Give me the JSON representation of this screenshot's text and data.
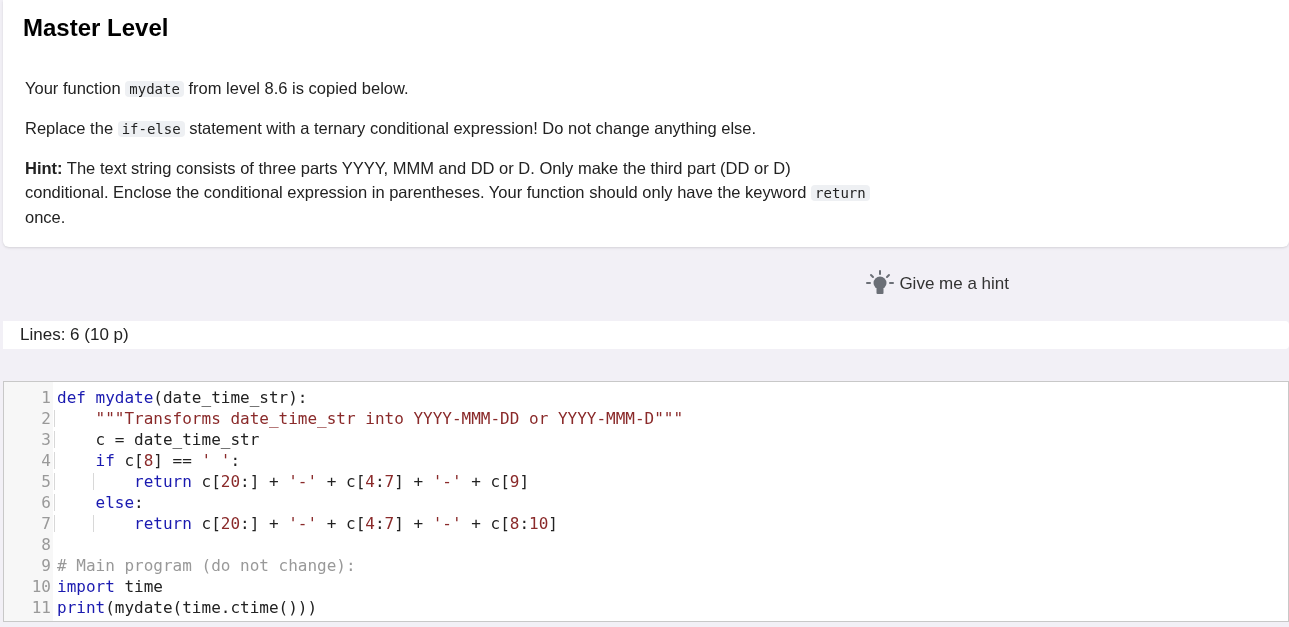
{
  "title": "Master Level",
  "paragraphs": [
    [
      {
        "kind": "text",
        "text": "Your function "
      },
      {
        "kind": "code",
        "text": "mydate"
      },
      {
        "kind": "text",
        "text": " from level 8.6 is copied below."
      }
    ],
    [
      {
        "kind": "text",
        "text": "Replace the "
      },
      {
        "kind": "code",
        "text": "if-else"
      },
      {
        "kind": "text",
        "text": " statement with a ternary conditional expression! Do not change anything else."
      }
    ],
    [
      {
        "kind": "bold",
        "text": "Hint:"
      },
      {
        "kind": "text",
        "text": " The text string consists of three parts YYYY, MMM and DD or D. Only make the third part (DD or D) conditional. Enclose the conditional expression in parentheses. Your function should only have the keyword "
      },
      {
        "kind": "code",
        "text": "return"
      },
      {
        "kind": "text",
        "text": " once."
      }
    ]
  ],
  "hint_button": "Give me a hint",
  "lines_info": "Lines: 6 (10 p)",
  "code_lines": [
    {
      "number": "1",
      "tokens": [
        {
          "kind": "kw",
          "text": "def "
        },
        {
          "kind": "fn",
          "text": "mydate"
        },
        {
          "kind": "plain",
          "text": "(date_time_str):"
        }
      ]
    },
    {
      "number": "2",
      "tokens": [
        {
          "kind": "str",
          "text": "    \"\"\"Transforms date_time_str into YYYY-MMM-DD or YYYY-MMM-D\"\"\""
        }
      ]
    },
    {
      "number": "3",
      "tokens": [
        {
          "kind": "plain",
          "text": "    c = date_time_str"
        }
      ]
    },
    {
      "number": "4",
      "tokens": [
        {
          "kind": "kw",
          "text": "    if"
        },
        {
          "kind": "plain",
          "text": " c["
        },
        {
          "kind": "num",
          "text": "8"
        },
        {
          "kind": "plain",
          "text": "] == "
        },
        {
          "kind": "str",
          "text": "' '"
        },
        {
          "kind": "plain",
          "text": ":"
        }
      ]
    },
    {
      "number": "5",
      "tokens": [
        {
          "kind": "kw",
          "text": "        return"
        },
        {
          "kind": "plain",
          "text": " c["
        },
        {
          "kind": "num",
          "text": "20"
        },
        {
          "kind": "plain",
          "text": ":] + "
        },
        {
          "kind": "str",
          "text": "'-'"
        },
        {
          "kind": "plain",
          "text": " + c["
        },
        {
          "kind": "num",
          "text": "4"
        },
        {
          "kind": "plain",
          "text": ":"
        },
        {
          "kind": "num",
          "text": "7"
        },
        {
          "kind": "plain",
          "text": "] + "
        },
        {
          "kind": "str",
          "text": "'-'"
        },
        {
          "kind": "plain",
          "text": " + c["
        },
        {
          "kind": "num",
          "text": "9"
        },
        {
          "kind": "plain",
          "text": "]"
        }
      ]
    },
    {
      "number": "6",
      "tokens": [
        {
          "kind": "kw",
          "text": "    else"
        },
        {
          "kind": "plain",
          "text": ":"
        }
      ]
    },
    {
      "number": "7",
      "tokens": [
        {
          "kind": "kw",
          "text": "        return"
        },
        {
          "kind": "plain",
          "text": " c["
        },
        {
          "kind": "num",
          "text": "20"
        },
        {
          "kind": "plain",
          "text": ":] + "
        },
        {
          "kind": "str",
          "text": "'-'"
        },
        {
          "kind": "plain",
          "text": " + c["
        },
        {
          "kind": "num",
          "text": "4"
        },
        {
          "kind": "plain",
          "text": ":"
        },
        {
          "kind": "num",
          "text": "7"
        },
        {
          "kind": "plain",
          "text": "] + "
        },
        {
          "kind": "str",
          "text": "'-'"
        },
        {
          "kind": "plain",
          "text": " + c["
        },
        {
          "kind": "num",
          "text": "8"
        },
        {
          "kind": "plain",
          "text": ":"
        },
        {
          "kind": "num",
          "text": "10"
        },
        {
          "kind": "plain",
          "text": "]"
        }
      ]
    },
    {
      "number": "8"
    },
    {
      "number": "9",
      "tokens": [
        {
          "kind": "cmt",
          "text": "# Main program (do not change):"
        }
      ]
    },
    {
      "number": "10",
      "tokens": [
        {
          "kind": "kw",
          "text": "import"
        },
        {
          "kind": "plain",
          "text": " time"
        }
      ]
    },
    {
      "number": "11",
      "tokens": [
        {
          "kind": "fn",
          "text": "print"
        },
        {
          "kind": "plain",
          "text": "(mydate(time.ctime()))"
        }
      ]
    }
  ]
}
